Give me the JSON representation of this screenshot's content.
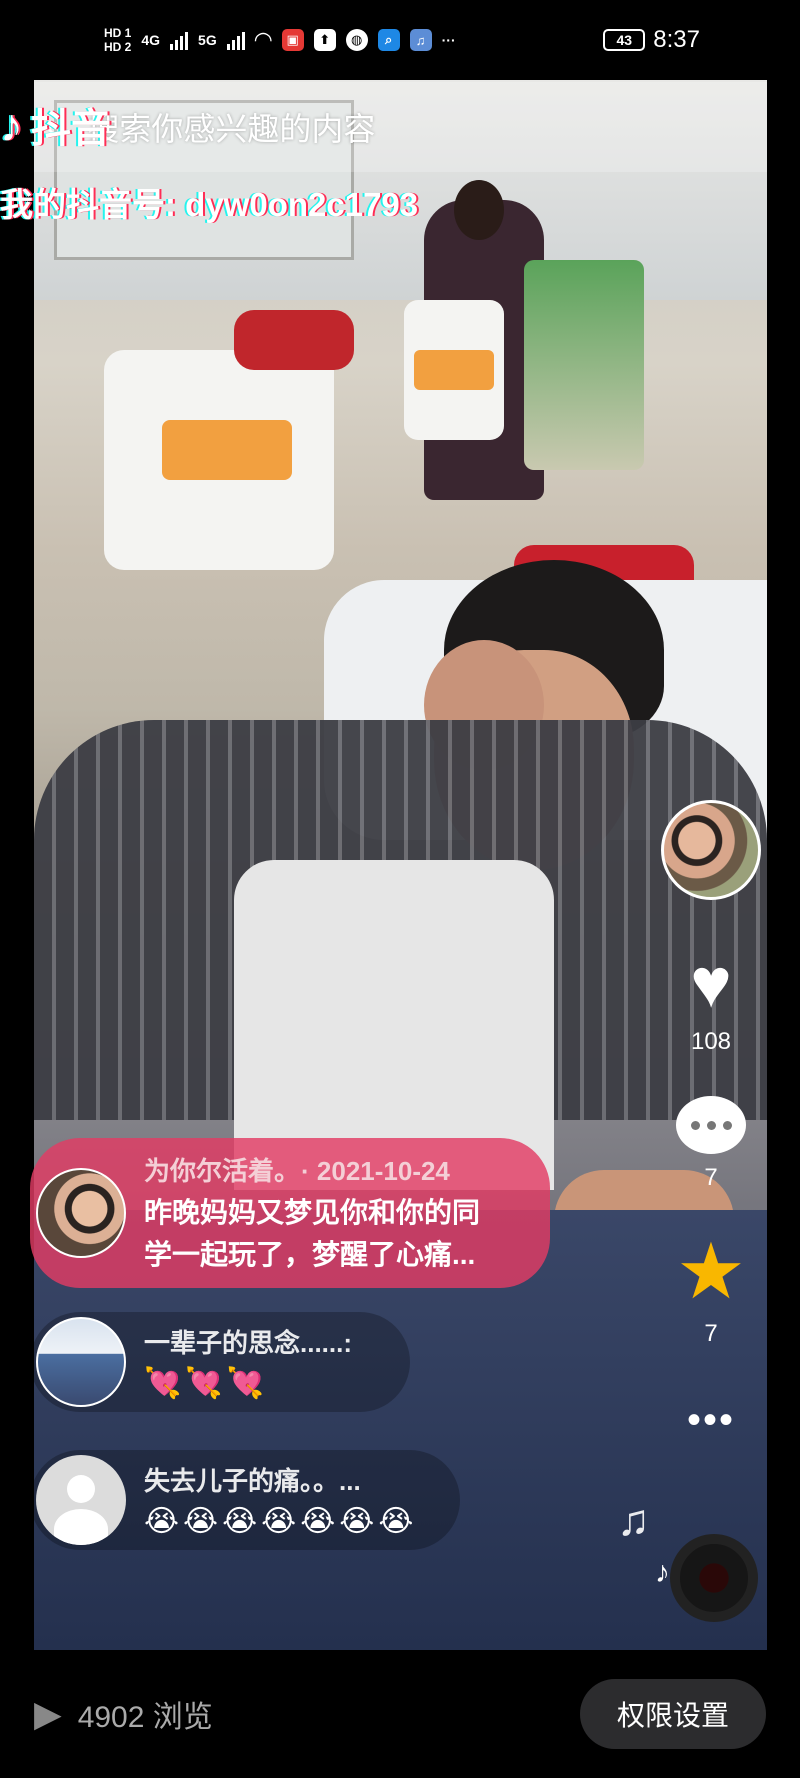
{
  "status_bar": {
    "hd1": "HD 1",
    "hd2": "HD 2",
    "net1": "4G",
    "net2": "5G",
    "more": "···",
    "battery": "43",
    "time": "8:37"
  },
  "header": {
    "watermark_logo": "抖音",
    "watermark_id": "我的抖音号: dyw0on2c1793",
    "search_placeholder": "搜索你感兴趣的内容"
  },
  "actions": {
    "like_count": "108",
    "comment_count": "7",
    "favorite_count": "7",
    "more": "•••"
  },
  "comments": [
    {
      "name": "为你尔活着。",
      "date": "· 2021-10-24",
      "text_line1": "昨晚妈妈又梦见你和你的同",
      "text_line2": "学一起玩了，梦醒了心痛..."
    },
    {
      "name": "一辈子的思念......:",
      "text": "💘💘💘"
    },
    {
      "name": "失去儿子的痛。。...",
      "text": "😭😭😭😭😭😭😭"
    }
  ],
  "bottom": {
    "views": "4902 浏览",
    "permission_button": "权限设置"
  },
  "colors": {
    "comment_highlight": "#e23c64",
    "star": "#f9b700"
  }
}
